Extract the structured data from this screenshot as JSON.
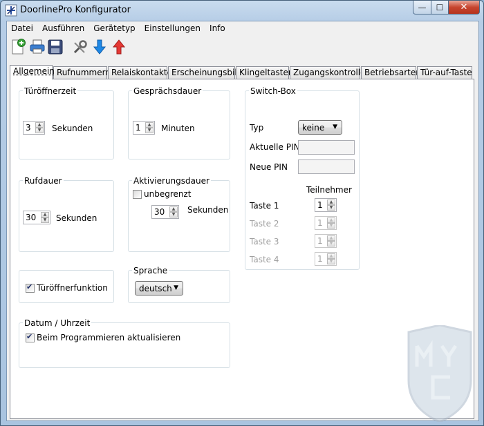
{
  "window": {
    "title": "DoorlinePro Konfigurator",
    "controls": {
      "minimize": "—",
      "maximize": "☐",
      "close": "✕"
    }
  },
  "menu": [
    "Datei",
    "Ausführen",
    "Gerätetyp",
    "Einstellungen",
    "Info"
  ],
  "toolbar": [
    "new-document-icon",
    "print-icon",
    "save-icon",
    "tools-icon",
    "download-arrow-icon",
    "upload-arrow-icon"
  ],
  "tabs": [
    "Allgemein",
    "Rufnummern",
    "Relaiskontakte",
    "Erscheinungsbild",
    "Klingeltasten",
    "Zugangskontrolle",
    "Betriebsarten",
    "Tür-auf-Taste"
  ],
  "active_tab": "Allgemein",
  "tueroeffnerzeit": {
    "label": "Türöffnerzeit",
    "value": "3",
    "unit": "Sekunden"
  },
  "gespraechsdauer": {
    "label": "Gesprächsdauer",
    "value": "1",
    "unit": "Minuten"
  },
  "rufdauer": {
    "label": "Rufdauer",
    "value": "30",
    "unit": "Sekunden"
  },
  "aktivierungsdauer": {
    "label": "Aktivierungsdauer",
    "checkbox_label": "unbegrenzt",
    "value": "30",
    "unit": "Sekunden"
  },
  "tueroeffnerfunktion": {
    "label": "Türöffnerfunktion"
  },
  "sprache": {
    "label": "Sprache",
    "value": "deutsch"
  },
  "datum": {
    "label": "Datum / Uhrzeit",
    "checkbox_label": "Beim Programmieren aktualisieren"
  },
  "switchbox": {
    "label": "Switch-Box",
    "typ_label": "Typ",
    "typ_value": "keine",
    "aktuelle_pin_label": "Aktuelle PIN",
    "neue_pin_label": "Neue PIN",
    "teilnehmer_label": "Teilnehmer",
    "tasten": [
      {
        "label": "Taste 1",
        "value": "1"
      },
      {
        "label": "Taste 2",
        "value": "1"
      },
      {
        "label": "Taste 3",
        "value": "1"
      },
      {
        "label": "Taste 4",
        "value": "1"
      }
    ]
  },
  "watermark_text": "MYC"
}
